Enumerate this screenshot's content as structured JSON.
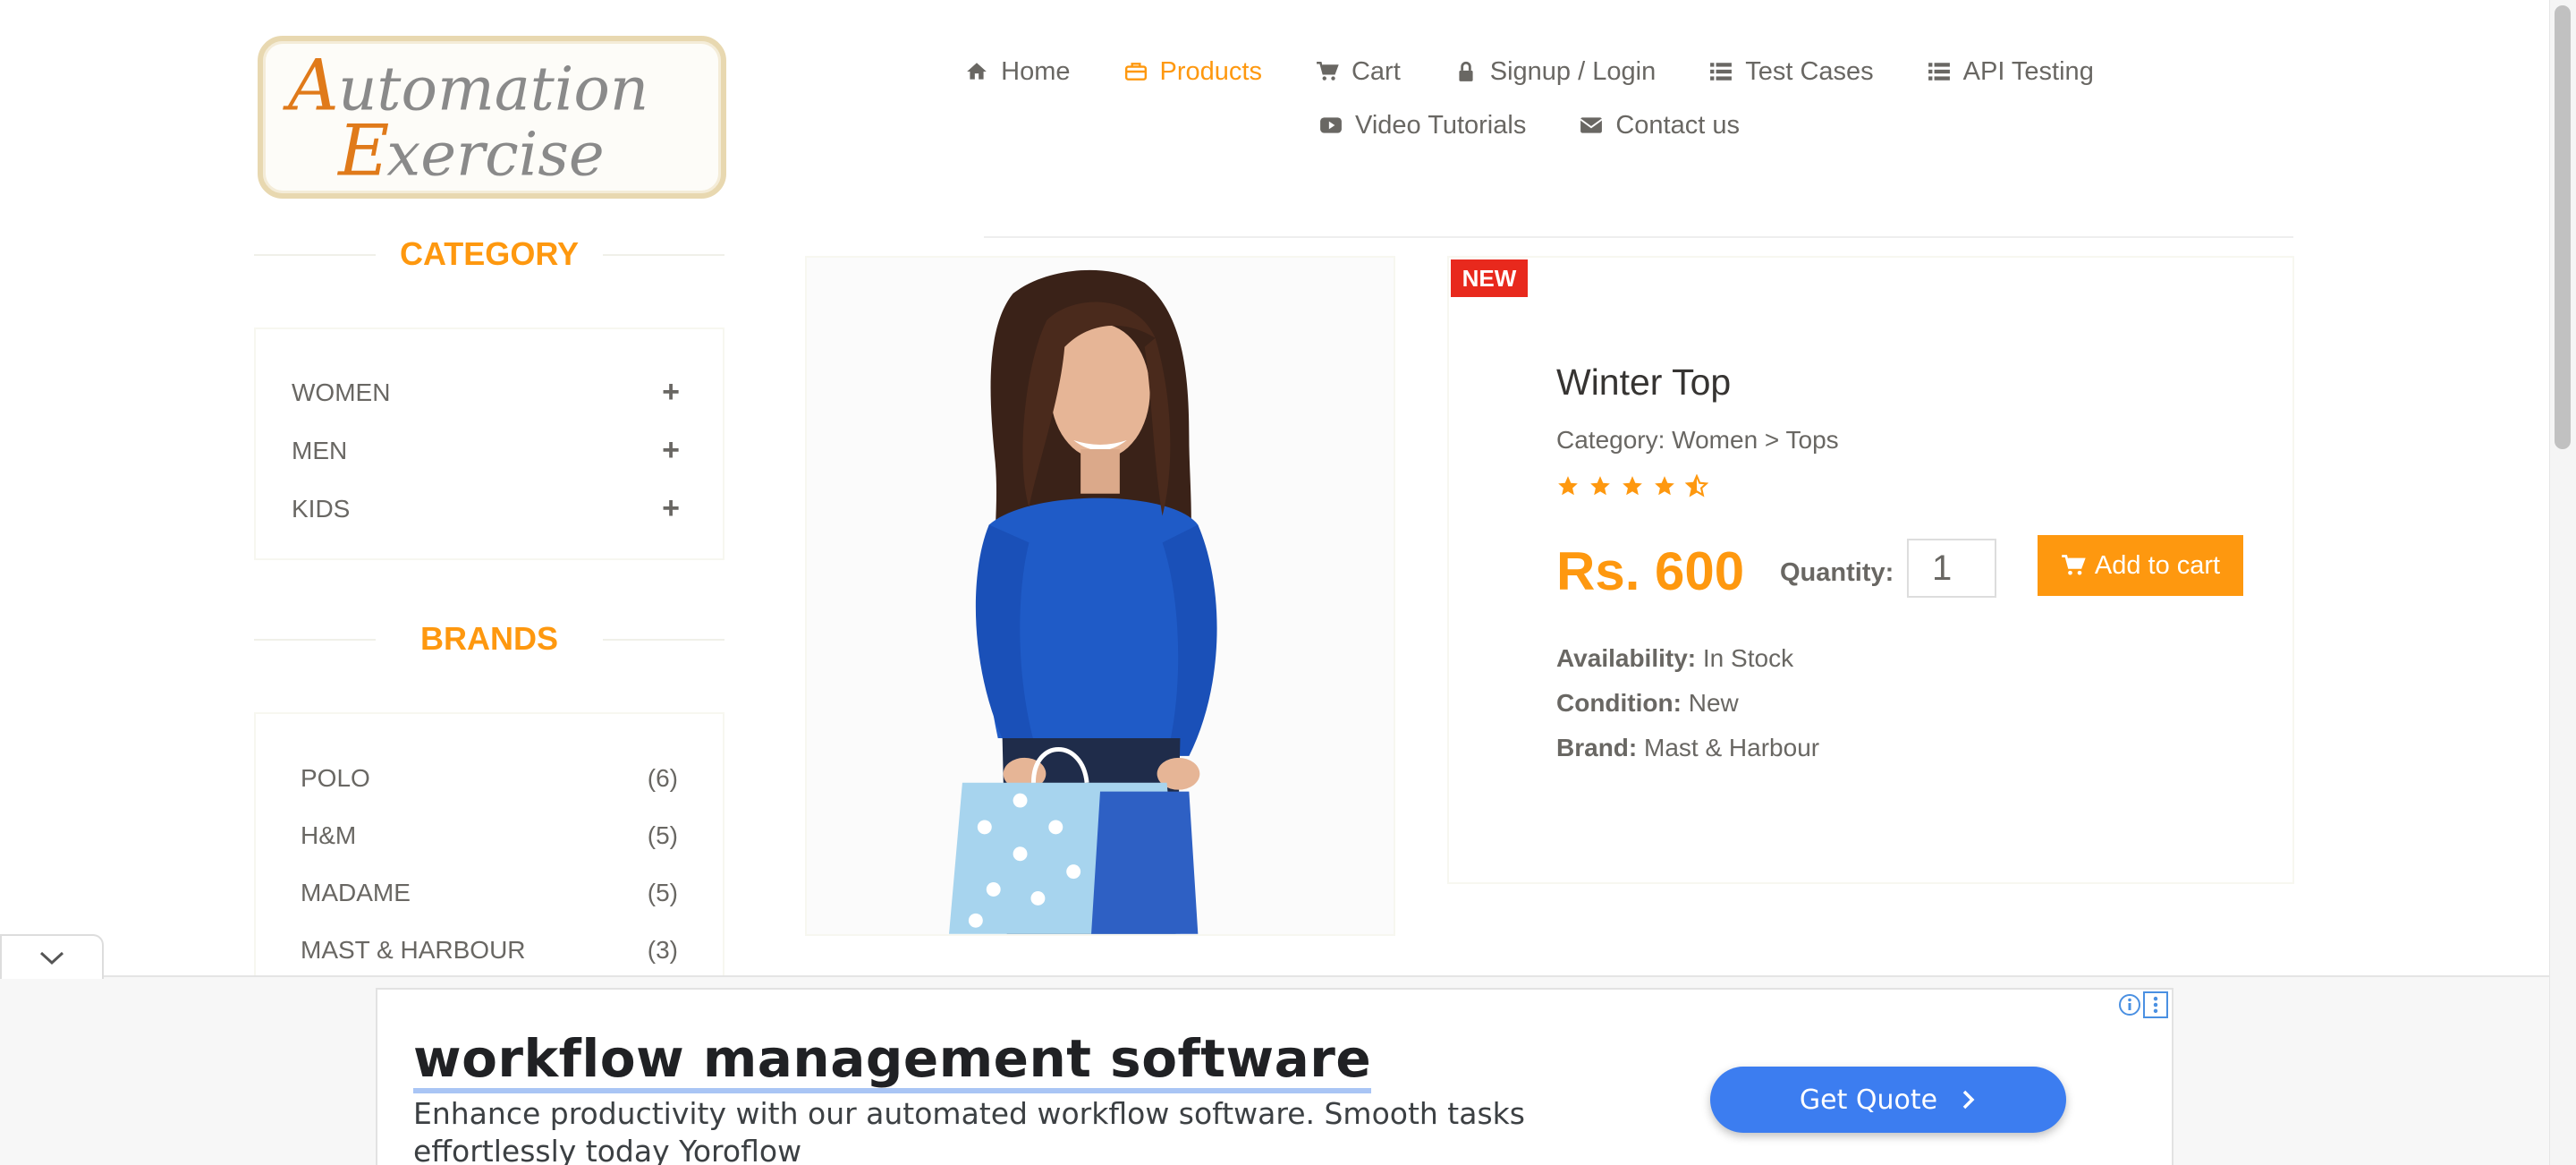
{
  "logo": {
    "line1": "Automation",
    "line2": "Exercise"
  },
  "nav": {
    "row1": [
      {
        "label": "Home",
        "icon": "home-icon"
      },
      {
        "label": "Products",
        "icon": "briefcase-icon",
        "active": true
      },
      {
        "label": "Cart",
        "icon": "cart-icon"
      },
      {
        "label": "Signup / Login",
        "icon": "lock-icon"
      },
      {
        "label": "Test Cases",
        "icon": "list-icon"
      },
      {
        "label": "API Testing",
        "icon": "list-icon"
      }
    ],
    "row2": [
      {
        "label": "Video Tutorials",
        "icon": "youtube-icon"
      },
      {
        "label": "Contact us",
        "icon": "envelope-icon"
      }
    ]
  },
  "sidebar": {
    "category_title": "CATEGORY",
    "categories": [
      {
        "label": "WOMEN",
        "toggle": "+"
      },
      {
        "label": "MEN",
        "toggle": "+"
      },
      {
        "label": "KIDS",
        "toggle": "+"
      }
    ],
    "brands_title": "BRANDS",
    "brands": [
      {
        "label": "POLO",
        "count": "(6)"
      },
      {
        "label": "H&M",
        "count": "(5)"
      },
      {
        "label": "MADAME",
        "count": "(5)"
      },
      {
        "label": "MAST & HARBOUR",
        "count": "(3)"
      }
    ]
  },
  "product": {
    "badge": "NEW",
    "name": "Winter Top",
    "category": "Category: Women > Tops",
    "rating": 4.5,
    "price": "Rs. 600",
    "quantity_label": "Quantity:",
    "quantity_value": "1",
    "add_to_cart": "Add to cart",
    "availability_label": "Availability:",
    "availability_value": "In Stock",
    "condition_label": "Condition:",
    "condition_value": "New",
    "brand_label": "Brand:",
    "brand_value": "Mast & Harbour"
  },
  "ad": {
    "headline": "workflow management software",
    "description": "Enhance productivity with our automated workflow software. Smooth tasks effortlessly today Yoroflow",
    "cta": "Get Quote"
  },
  "colors": {
    "accent": "#fe980f",
    "badge": "#e8291d",
    "ad_button": "#3c7df0",
    "text": "#696763"
  }
}
